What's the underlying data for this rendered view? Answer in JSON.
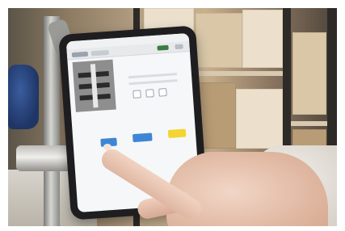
{
  "scene": {
    "subject": "",
    "colors": {
      "accent_blue": "#3d86d6",
      "accent_yellow": "#f2d533",
      "badge_green": "#3a7d44"
    }
  }
}
